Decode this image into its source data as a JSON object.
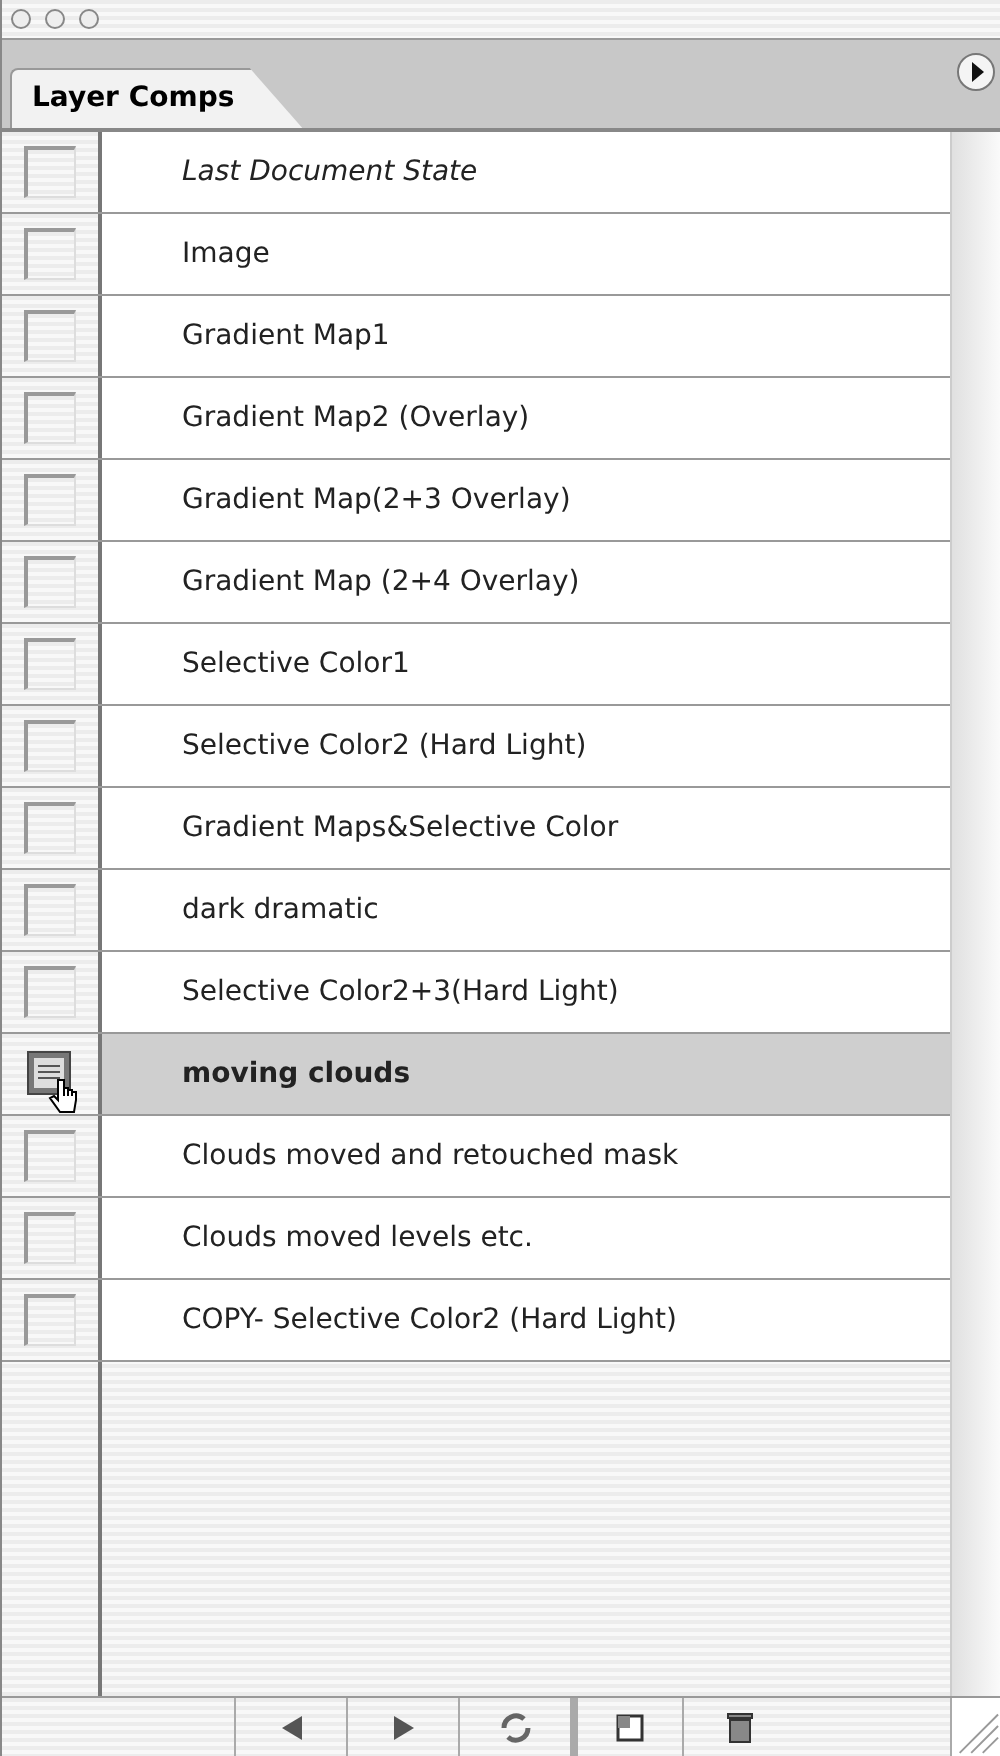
{
  "panel": {
    "tab": "Layer Comps"
  },
  "comps": [
    {
      "name": "Last Document State",
      "kind": "last_state",
      "selected": false
    },
    {
      "name": "Image",
      "kind": "comp",
      "selected": false
    },
    {
      "name": "Gradient Map1",
      "kind": "comp",
      "selected": false
    },
    {
      "name": "Gradient Map2 (Overlay)",
      "kind": "comp",
      "selected": false
    },
    {
      "name": "Gradient Map(2+3 Overlay)",
      "kind": "comp",
      "selected": false
    },
    {
      "name": "Gradient Map (2+4 Overlay)",
      "kind": "comp",
      "selected": false
    },
    {
      "name": "Selective Color1",
      "kind": "comp",
      "selected": false
    },
    {
      "name": "Selective Color2 (Hard Light)",
      "kind": "comp",
      "selected": false
    },
    {
      "name": "Gradient Maps&Selective Color",
      "kind": "comp",
      "selected": false
    },
    {
      "name": "dark dramatic",
      "kind": "comp",
      "selected": false
    },
    {
      "name": "Selective Color2+3(Hard Light)",
      "kind": "comp",
      "selected": false
    },
    {
      "name": "moving clouds",
      "kind": "comp",
      "selected": true
    },
    {
      "name": "Clouds moved and retouched mask",
      "kind": "comp",
      "selected": false
    },
    {
      "name": "Clouds moved levels etc.",
      "kind": "comp",
      "selected": false
    },
    {
      "name": "COPY- Selective Color2 (Hard Light)",
      "kind": "comp",
      "selected": false
    }
  ]
}
